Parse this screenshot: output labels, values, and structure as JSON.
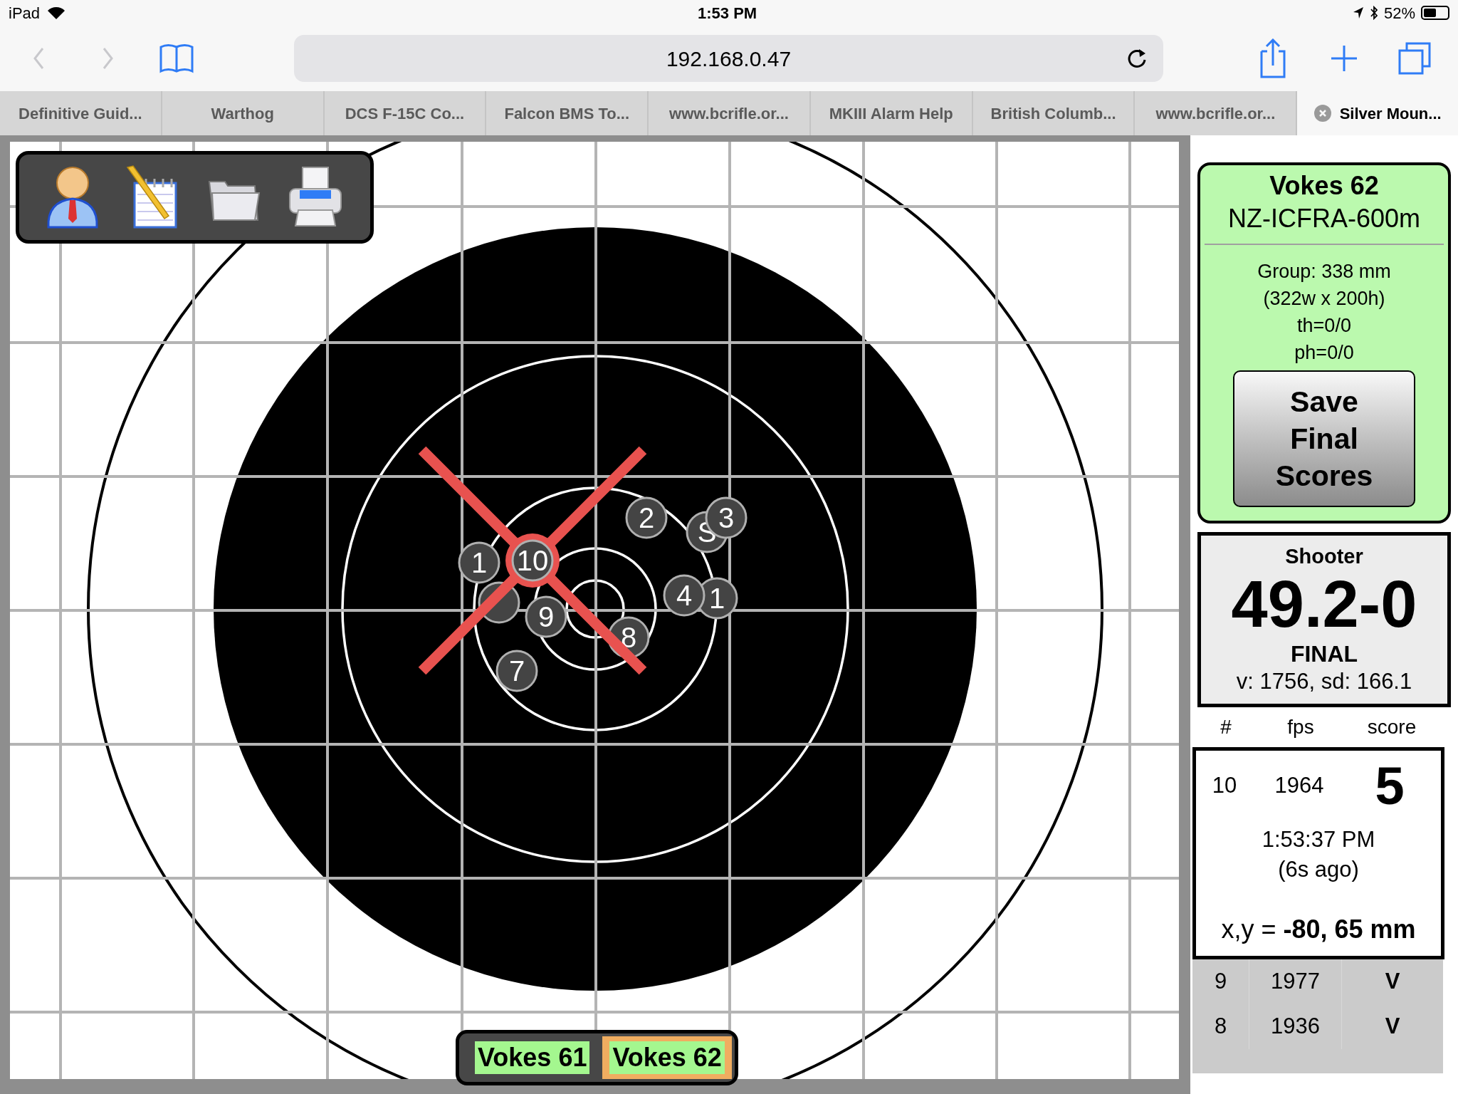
{
  "status_bar": {
    "device": "iPad",
    "time": "1:53 PM",
    "battery": "52%"
  },
  "browser": {
    "url": "192.168.0.47",
    "back_disabled": true,
    "forward_disabled": true
  },
  "tabs": [
    {
      "label": "Definitive Guid...",
      "selected": false
    },
    {
      "label": "Warthog",
      "selected": false
    },
    {
      "label": "DCS F-15C Co...",
      "selected": false
    },
    {
      "label": "Falcon BMS To...",
      "selected": false
    },
    {
      "label": "www.bcrifle.or...",
      "selected": false
    },
    {
      "label": "MKIII Alarm Help",
      "selected": false
    },
    {
      "label": "British Columb...",
      "selected": false
    },
    {
      "label": "www.bcrifle.or...",
      "selected": false
    },
    {
      "label": "Silver Moun...",
      "selected": true
    }
  ],
  "target": {
    "shots": [
      {
        "label": "2",
        "selected": false
      },
      {
        "label": "S",
        "selected": false
      },
      {
        "label": "3",
        "selected": false
      },
      {
        "selected": false
      },
      {
        "label": "1",
        "selected": false
      },
      {
        "label": "10",
        "selected": true
      },
      {
        "label": "9",
        "selected": false
      },
      {
        "label": "1",
        "selected": false
      },
      {
        "label": "4",
        "selected": false
      },
      {
        "label": "8",
        "selected": false
      },
      {
        "label": "7",
        "selected": false
      }
    ]
  },
  "shooter_tabs": [
    {
      "label": "Vokes 61",
      "selected": false
    },
    {
      "label": "Vokes 62",
      "selected": true
    }
  ],
  "panel": {
    "title": "Vokes 62",
    "course": "NZ-ICFRA-600m",
    "group_lines": [
      "Group: 338 mm",
      "(322w x 200h)",
      "th=0/0",
      "ph=0/0"
    ],
    "save_button": "Save Final Scores"
  },
  "score": {
    "label": "Shooter",
    "total": "49.2-0",
    "status": "FINAL",
    "stats": "v: 1756, sd: 166.1"
  },
  "shot_table": {
    "columns": [
      "#",
      "fps",
      "score"
    ],
    "current": {
      "number": "10",
      "fps": "1964",
      "score": "5",
      "time": "1:53:37 PM",
      "ago": "(6s ago)",
      "position": "x,y = **-80, 65 mm**"
    },
    "rows": [
      {
        "number": "9",
        "fps": "1977",
        "score": "V"
      },
      {
        "number": "8",
        "fps": "1936",
        "score": "V"
      }
    ]
  }
}
